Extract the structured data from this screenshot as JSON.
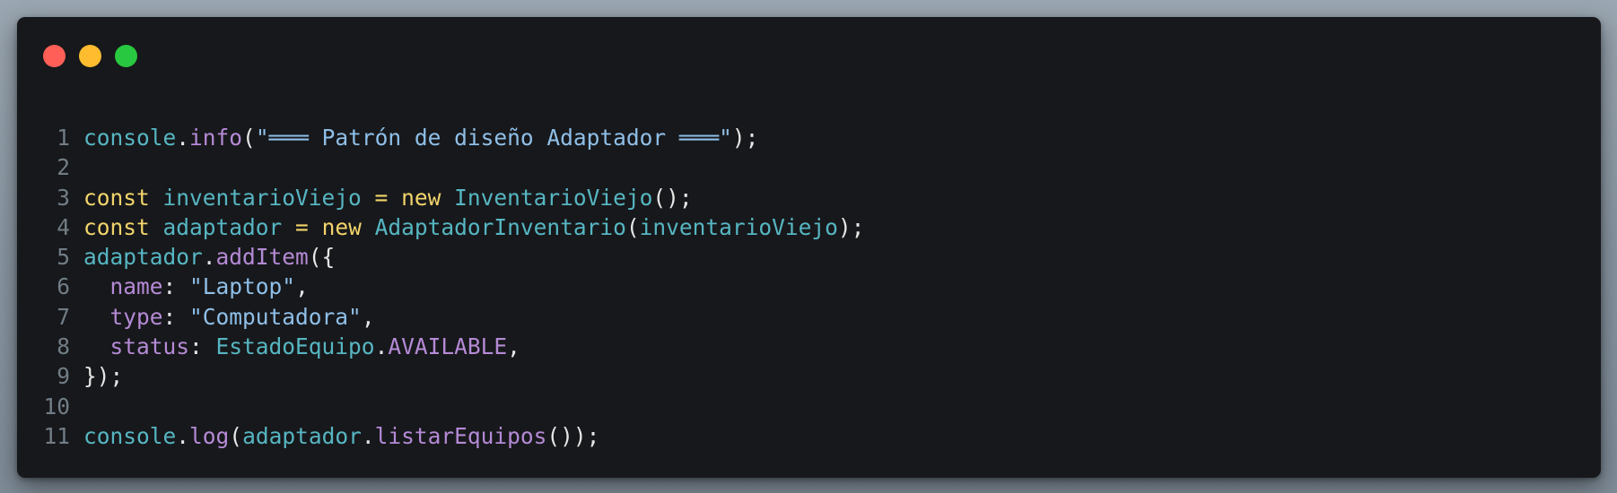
{
  "window": {
    "traffic_lights": [
      {
        "name": "close",
        "color": "#ff5f57"
      },
      {
        "name": "minimize",
        "color": "#febc2e"
      },
      {
        "name": "maximize",
        "color": "#28c840"
      }
    ]
  },
  "colors": {
    "background": "#17181b",
    "default": "#e6e6e6",
    "line_number": "#717d86",
    "identifier": "#56b6c2",
    "method": "#b58ad6",
    "keyword": "#f2d46b",
    "string": "#8fbfe8"
  },
  "lines": [
    {
      "n": "1",
      "tokens": [
        {
          "t": "console",
          "k": "identifier"
        },
        {
          "t": ".",
          "k": "default"
        },
        {
          "t": "info",
          "k": "method"
        },
        {
          "t": "(",
          "k": "default"
        },
        {
          "t": "\"═══ Patrón de diseño Adaptador ═══\"",
          "k": "string"
        },
        {
          "t": ");",
          "k": "default"
        }
      ]
    },
    {
      "n": "2",
      "tokens": []
    },
    {
      "n": "3",
      "tokens": [
        {
          "t": "const",
          "k": "keyword"
        },
        {
          "t": " ",
          "k": "default"
        },
        {
          "t": "inventarioViejo",
          "k": "identifier"
        },
        {
          "t": " = ",
          "k": "keyword"
        },
        {
          "t": "new",
          "k": "keyword"
        },
        {
          "t": " ",
          "k": "default"
        },
        {
          "t": "InventarioViejo",
          "k": "identifier"
        },
        {
          "t": "();",
          "k": "default"
        }
      ]
    },
    {
      "n": "4",
      "tokens": [
        {
          "t": "const",
          "k": "keyword"
        },
        {
          "t": " ",
          "k": "default"
        },
        {
          "t": "adaptador",
          "k": "identifier"
        },
        {
          "t": " = ",
          "k": "keyword"
        },
        {
          "t": "new",
          "k": "keyword"
        },
        {
          "t": " ",
          "k": "default"
        },
        {
          "t": "AdaptadorInventario",
          "k": "identifier"
        },
        {
          "t": "(",
          "k": "default"
        },
        {
          "t": "inventarioViejo",
          "k": "identifier"
        },
        {
          "t": ");",
          "k": "default"
        }
      ]
    },
    {
      "n": "5",
      "tokens": [
        {
          "t": "adaptador",
          "k": "identifier"
        },
        {
          "t": ".",
          "k": "default"
        },
        {
          "t": "addItem",
          "k": "method"
        },
        {
          "t": "({",
          "k": "default"
        }
      ]
    },
    {
      "n": "6",
      "tokens": [
        {
          "t": "  ",
          "k": "default"
        },
        {
          "t": "name",
          "k": "method"
        },
        {
          "t": ": ",
          "k": "default"
        },
        {
          "t": "\"Laptop\"",
          "k": "string"
        },
        {
          "t": ",",
          "k": "default"
        }
      ]
    },
    {
      "n": "7",
      "tokens": [
        {
          "t": "  ",
          "k": "default"
        },
        {
          "t": "type",
          "k": "method"
        },
        {
          "t": ": ",
          "k": "default"
        },
        {
          "t": "\"Computadora\"",
          "k": "string"
        },
        {
          "t": ",",
          "k": "default"
        }
      ]
    },
    {
      "n": "8",
      "tokens": [
        {
          "t": "  ",
          "k": "default"
        },
        {
          "t": "status",
          "k": "method"
        },
        {
          "t": ": ",
          "k": "default"
        },
        {
          "t": "EstadoEquipo",
          "k": "identifier"
        },
        {
          "t": ".",
          "k": "default"
        },
        {
          "t": "AVAILABLE",
          "k": "method"
        },
        {
          "t": ",",
          "k": "default"
        }
      ]
    },
    {
      "n": "9",
      "tokens": [
        {
          "t": "});",
          "k": "default"
        }
      ]
    },
    {
      "n": "10",
      "tokens": []
    },
    {
      "n": "11",
      "tokens": [
        {
          "t": "console",
          "k": "identifier"
        },
        {
          "t": ".",
          "k": "default"
        },
        {
          "t": "log",
          "k": "method"
        },
        {
          "t": "(",
          "k": "default"
        },
        {
          "t": "adaptador",
          "k": "identifier"
        },
        {
          "t": ".",
          "k": "default"
        },
        {
          "t": "listarEquipos",
          "k": "method"
        },
        {
          "t": "());",
          "k": "default"
        }
      ]
    }
  ]
}
